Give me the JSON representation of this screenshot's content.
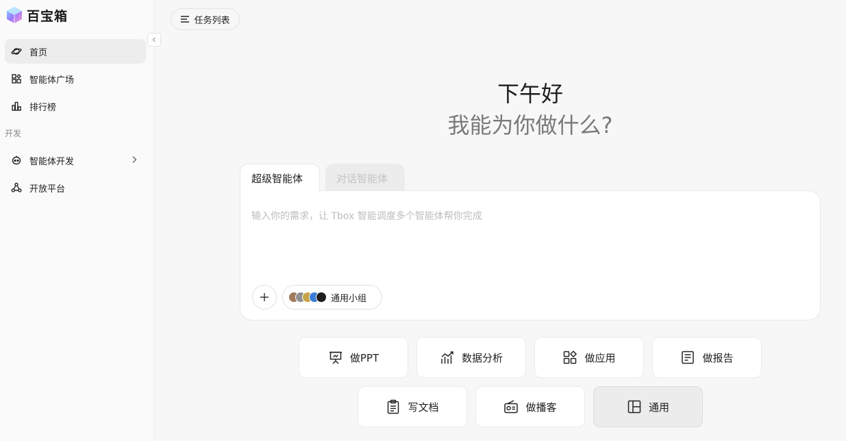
{
  "app": {
    "name": "百宝箱"
  },
  "sidebar": {
    "items": [
      {
        "label": "首页",
        "icon": "planet-icon",
        "active": true
      },
      {
        "label": "智能体广场",
        "icon": "grid-icon",
        "active": false
      },
      {
        "label": "排行榜",
        "icon": "bar-chart-icon",
        "active": false
      }
    ],
    "section_label": "开发",
    "dev_items": [
      {
        "label": "智能体开发",
        "icon": "robot-icon",
        "has_chevron": true
      },
      {
        "label": "开放平台",
        "icon": "network-icon",
        "has_chevron": false
      }
    ]
  },
  "header": {
    "task_list_label": "任务列表"
  },
  "greeting": {
    "line1": "下午好",
    "line2": "我能为你做什么?"
  },
  "composer": {
    "tabs": [
      {
        "label": "超级智能体",
        "active": true
      },
      {
        "label": "对话智能体",
        "active": false
      }
    ],
    "placeholder": "输入你的需求，让 Tbox 智能调度多个智能体帮你完成",
    "group_label": "通用小组"
  },
  "actions": [
    {
      "label": "做PPT",
      "icon": "presentation-icon",
      "selected": false
    },
    {
      "label": "数据分析",
      "icon": "trend-chart-icon",
      "selected": false
    },
    {
      "label": "做应用",
      "icon": "apps-icon",
      "selected": false
    },
    {
      "label": "做报告",
      "icon": "document-icon",
      "selected": false
    },
    {
      "label": "写文档",
      "icon": "clipboard-icon",
      "selected": false
    },
    {
      "label": "做播客",
      "icon": "radio-icon",
      "selected": false
    },
    {
      "label": "通用",
      "icon": "layout-icon",
      "selected": true
    }
  ],
  "colors": {
    "accent_active_bg": "#ededed",
    "text": "#1f1f1f",
    "muted": "#7a7a7a"
  }
}
